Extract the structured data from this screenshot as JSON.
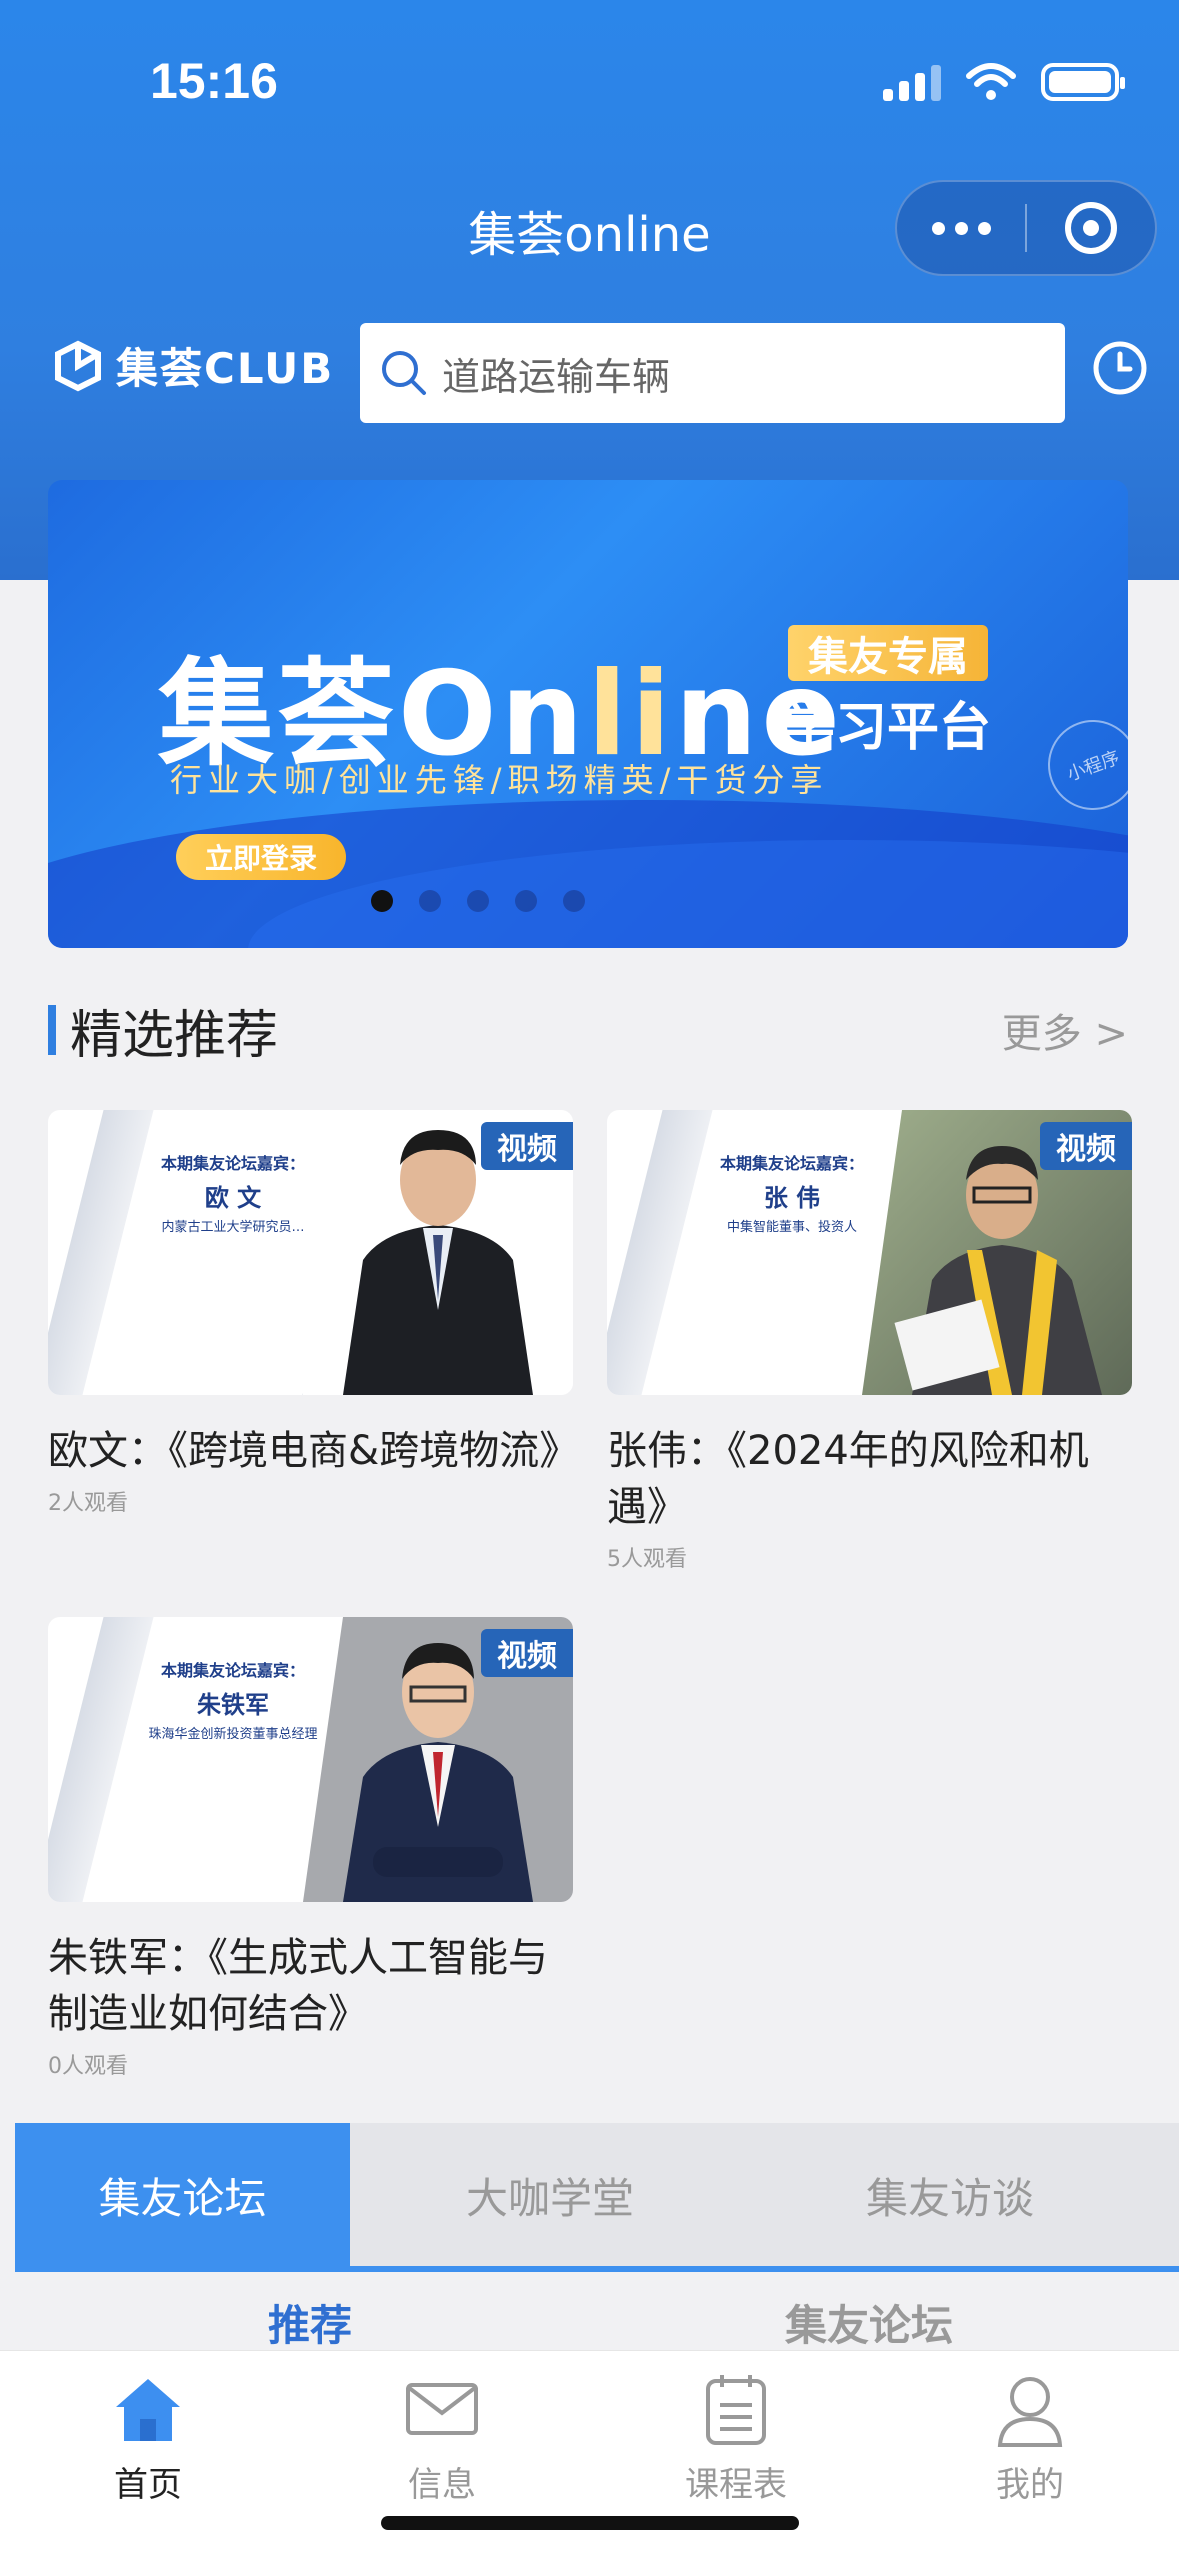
{
  "status_bar": {
    "time": "15:16"
  },
  "nav_bar": {
    "title": "集荟online"
  },
  "brand": {
    "logo_text": "集荟CLUB"
  },
  "search": {
    "placeholder": "道路运输车辆"
  },
  "banner": {
    "title_cn": "集荟",
    "title_en_pre": "On",
    "title_en_hl": "li",
    "title_en_post": "ne",
    "tag": "集友专属",
    "subtitle": "学习平台",
    "slogan": "行业大咖/创业先锋/职场精英/干货分享",
    "button": "立即登录",
    "mini_badge": "小程序",
    "slide_count": 5,
    "active_slide": 1
  },
  "section": {
    "title": "精选推荐",
    "more": "更多 >"
  },
  "cards": [
    {
      "badge": "视频",
      "guest_head": "本期集友论坛嘉宾：",
      "guest_name": "欧 文",
      "guest_desc": "内蒙古工业大学研究员…",
      "title": "欧文：《跨境电商&跨境物流》",
      "views": "2人观看"
    },
    {
      "badge": "视频",
      "guest_head": "本期集友论坛嘉宾：",
      "guest_name": "张 伟",
      "guest_desc": "中集智能董事、投资人",
      "title": "张伟：《2024年的风险和机遇》",
      "views": "5人观看"
    },
    {
      "badge": "视频",
      "guest_head": "本期集友论坛嘉宾：",
      "guest_name": "朱铁军",
      "guest_desc": "珠海华金创新投资董事总经理",
      "title": "朱铁军：《生成式人工智能与制造业如何结合》",
      "views": "0人观看"
    }
  ],
  "tabs": [
    {
      "label": "集友论坛",
      "active": true
    },
    {
      "label": "大咖学堂",
      "active": false
    },
    {
      "label": "集友访谈",
      "active": false
    }
  ],
  "subtabs": [
    {
      "label": "推荐"
    },
    {
      "label": "集友论坛"
    }
  ],
  "bottom_nav": [
    {
      "label": "首页",
      "icon": "home-icon",
      "active": true
    },
    {
      "label": "信息",
      "icon": "mail-icon",
      "active": false
    },
    {
      "label": "课程表",
      "icon": "calendar-icon",
      "active": false
    },
    {
      "label": "我的",
      "icon": "user-icon",
      "active": false
    }
  ],
  "colors": {
    "primary": "#2f7fe0",
    "accent": "#f8b52c",
    "badge": "#2665b8"
  }
}
